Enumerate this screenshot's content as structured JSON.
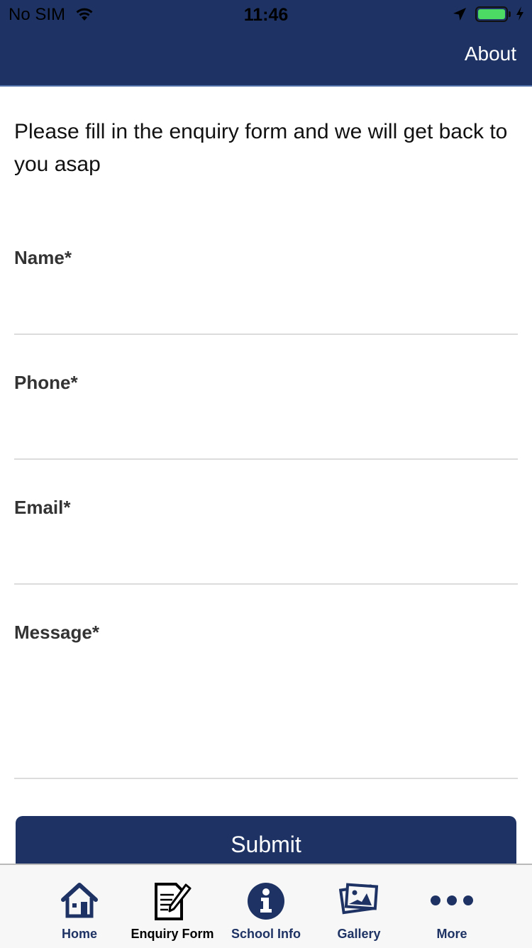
{
  "status_bar": {
    "carrier": "No SIM",
    "time": "11:46",
    "battery_color": "#4cd964"
  },
  "header": {
    "about_label": "About",
    "background": "#1e3364"
  },
  "intro_text": "Please fill in the enquiry form and we will get back to you asap",
  "form": {
    "fields": [
      {
        "label": "Name*",
        "value": ""
      },
      {
        "label": "Phone*",
        "value": ""
      },
      {
        "label": "Email*",
        "value": ""
      },
      {
        "label": "Message*",
        "value": ""
      }
    ],
    "submit_label": "Submit"
  },
  "tabbar": {
    "items": [
      {
        "label": "Home",
        "icon": "home-icon",
        "active": false
      },
      {
        "label": "Enquiry Form",
        "icon": "document-pencil-icon",
        "active": true
      },
      {
        "label": "School Info",
        "icon": "info-icon",
        "active": false
      },
      {
        "label": "Gallery",
        "icon": "gallery-icon",
        "active": false
      },
      {
        "label": "More",
        "icon": "more-dots-icon",
        "active": false
      }
    ]
  }
}
